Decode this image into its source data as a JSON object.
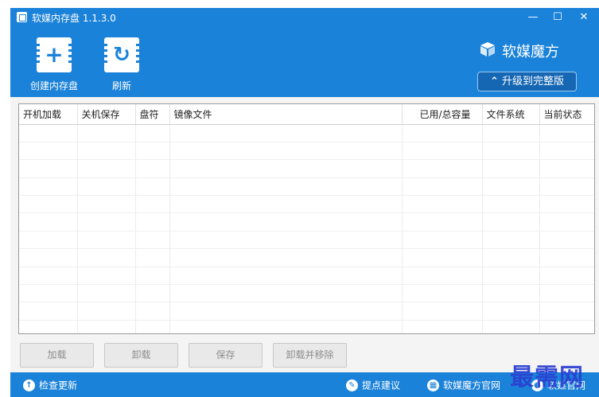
{
  "window": {
    "title": "软媒内存盘 1.1.3.0"
  },
  "titlebar": {
    "minimize_glyph": "—",
    "maximize_glyph": "☐",
    "close_glyph": "✕"
  },
  "toolbar": {
    "create_label": "创建内存盘",
    "refresh_label": "刷新"
  },
  "brand": {
    "name": "软媒魔方",
    "upgrade_label": "升级到完整版",
    "upgrade_glyph": "⌃"
  },
  "table": {
    "headers": [
      "开机加载",
      "关机保存",
      "盘符",
      "镜像文件",
      "已用/总容量",
      "文件系统",
      "当前状态"
    ],
    "rows": []
  },
  "actions": {
    "load": "加载",
    "unload": "卸载",
    "save": "保存",
    "unload_remove": "卸载并移除"
  },
  "statusbar": {
    "check_update": "检查更新",
    "feedback": "提点建议",
    "mofang_site": "软媒魔方官网",
    "ruanmei_site": "软媒官网"
  },
  "watermark": "最需网",
  "colors": {
    "accent": "#1b82d9",
    "accent_dark": "#1566b3",
    "watermark": "#2c3fd2"
  }
}
